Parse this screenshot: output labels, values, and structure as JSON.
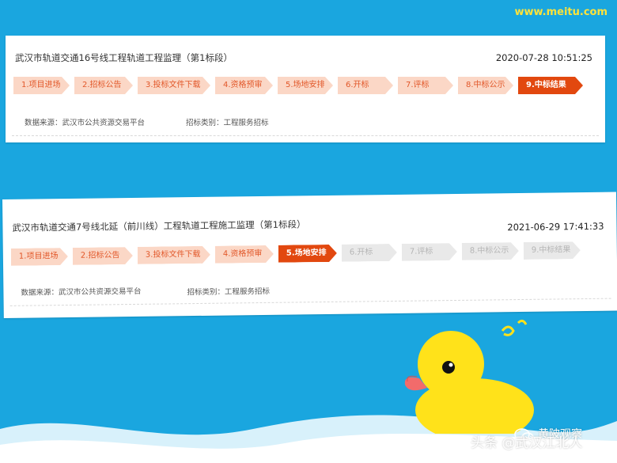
{
  "watermark": "www.meitu.com",
  "card1": {
    "title": "武汉市轨道交通16号线工程轨道工程监理（第1标段）",
    "time": "2020-07-28 10:51:25",
    "steps": [
      {
        "label": "1.项目进场",
        "state": "done"
      },
      {
        "label": "2.招标公告",
        "state": "done"
      },
      {
        "label": "3.投标文件下载",
        "state": "done"
      },
      {
        "label": "4.资格预审",
        "state": "done"
      },
      {
        "label": "5.场地安排",
        "state": "done"
      },
      {
        "label": "6.开标",
        "state": "done"
      },
      {
        "label": "7.评标",
        "state": "done"
      },
      {
        "label": "8.中标公示",
        "state": "done"
      },
      {
        "label": "9.中标结果",
        "state": "active"
      }
    ],
    "source": "数据来源：武汉市公共资源交易平台",
    "category": "招标类别：工程服务招标"
  },
  "card2": {
    "title": "武汉市轨道交通7号线北延（前川线）工程轨道工程施工监理（第1标段）",
    "time": "2021-06-29 17:41:33",
    "steps": [
      {
        "label": "1.项目进场",
        "state": "done"
      },
      {
        "label": "2.招标公告",
        "state": "done"
      },
      {
        "label": "3.投标文件下载",
        "state": "done"
      },
      {
        "label": "4.资格预审",
        "state": "done"
      },
      {
        "label": "5.场地安排",
        "state": "active"
      },
      {
        "label": "6.开标",
        "state": "pending"
      },
      {
        "label": "7.评标",
        "state": "pending"
      },
      {
        "label": "8.中标公示",
        "state": "pending"
      },
      {
        "label": "9.中标结果",
        "state": "pending"
      }
    ],
    "source": "数据来源：武汉市公共资源交易平台",
    "category": "招标类别：工程服务招标"
  },
  "footer": {
    "line1": "头条 @武汉江北人",
    "line2": "黄陂观察"
  },
  "colors": {
    "background": "#1aa6df",
    "step_done": "#fbd7c6",
    "step_active": "#e2480f",
    "step_pending": "#e9e9e9",
    "duck": "#ffe21a",
    "beak": "#f26b6b"
  }
}
